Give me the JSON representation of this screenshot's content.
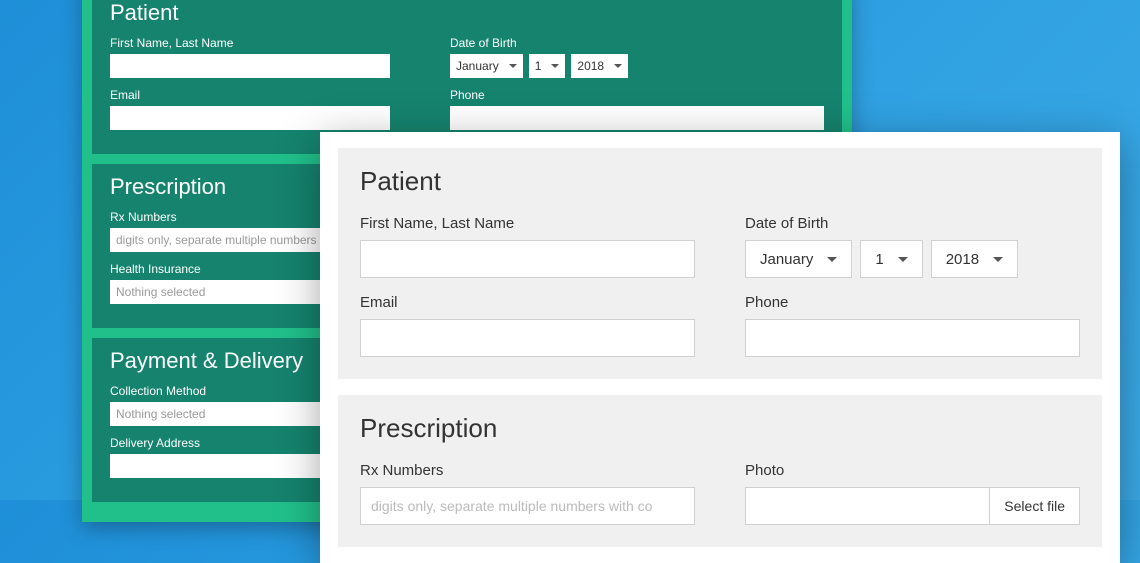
{
  "green": {
    "patient": {
      "title": "Patient",
      "name_label": "First Name, Last Name",
      "dob_label": "Date of Birth",
      "dob_month": "January",
      "dob_day": "1",
      "dob_year": "2018",
      "email_label": "Email",
      "phone_label": "Phone"
    },
    "prescription": {
      "title": "Prescription",
      "rx_label": "Rx Numbers",
      "rx_placeholder": "digits only, separate multiple numbers w",
      "hi_label": "Health Insurance",
      "hi_placeholder": "Nothing selected"
    },
    "payment": {
      "title": "Payment & Delivery",
      "cm_label": "Collection Method",
      "cm_placeholder": "Nothing selected",
      "addr_label": "Delivery Address"
    }
  },
  "white": {
    "patient": {
      "title": "Patient",
      "name_label": "First Name, Last Name",
      "dob_label": "Date of Birth",
      "dob_month": "January",
      "dob_day": "1",
      "dob_year": "2018",
      "email_label": "Email",
      "phone_label": "Phone"
    },
    "prescription": {
      "title": "Prescription",
      "rx_label": "Rx Numbers",
      "rx_placeholder": "digits only, separate multiple numbers with co",
      "photo_label": "Photo",
      "file_button": "Select file"
    }
  }
}
